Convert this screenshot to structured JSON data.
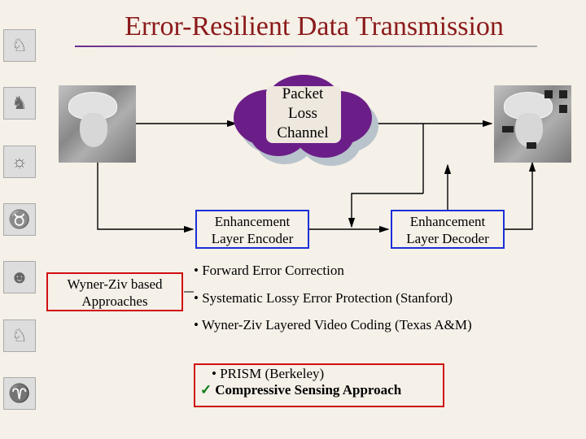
{
  "title": "Error-Resilient Data Transmission",
  "cloud_label": "Packet\nLoss\nChannel",
  "encoder_label": "Enhancement\nLayer Encoder",
  "decoder_label": "Enhancement\nLayer Decoder",
  "wyner_ziv_label": "Wyner-Ziv based\nApproaches",
  "bullets": {
    "b1": "• Forward Error Correction",
    "b2": "• Systematic Lossy Error Protection (Stanford)",
    "b3": "• Wyner-Ziv Layered Video Coding (Texas A&M)"
  },
  "final": {
    "line1": "• PRISM (Berkeley)",
    "line2": "Compressive Sensing Approach"
  },
  "sidebar_icons": [
    "knight-icon",
    "unicorn-icon",
    "cherub-icon",
    "bull-icon",
    "face-icon",
    "pegasus-icon",
    "deer-icon"
  ]
}
